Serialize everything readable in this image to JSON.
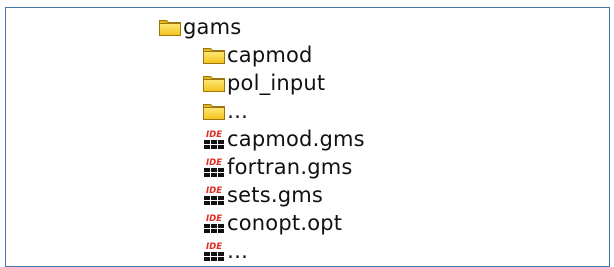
{
  "tree": {
    "root": {
      "label": "gams",
      "icon": "folder-icon"
    },
    "children": [
      {
        "label": "capmod",
        "icon": "folder-icon",
        "kind": "folder"
      },
      {
        "label": "pol_input",
        "icon": "folder-icon",
        "kind": "folder"
      },
      {
        "label": "…",
        "icon": "folder-icon",
        "kind": "folder"
      },
      {
        "label": "capmod.gms",
        "icon": "gams-ide-file-icon",
        "kind": "file"
      },
      {
        "label": "fortran.gms",
        "icon": "gams-ide-file-icon",
        "kind": "file"
      },
      {
        "label": "sets.gms",
        "icon": "gams-ide-file-icon",
        "kind": "file"
      },
      {
        "label": "conopt.opt",
        "icon": "gams-ide-file-icon",
        "kind": "file"
      },
      {
        "label": "…",
        "icon": "gams-ide-file-icon",
        "kind": "file"
      }
    ],
    "ide_badge_text": "IDE"
  },
  "colors": {
    "frame_border": "#4a74ad",
    "folder_fill": "#f7d02c",
    "folder_stroke": "#a07a10",
    "ide_red": "#e02a20"
  }
}
